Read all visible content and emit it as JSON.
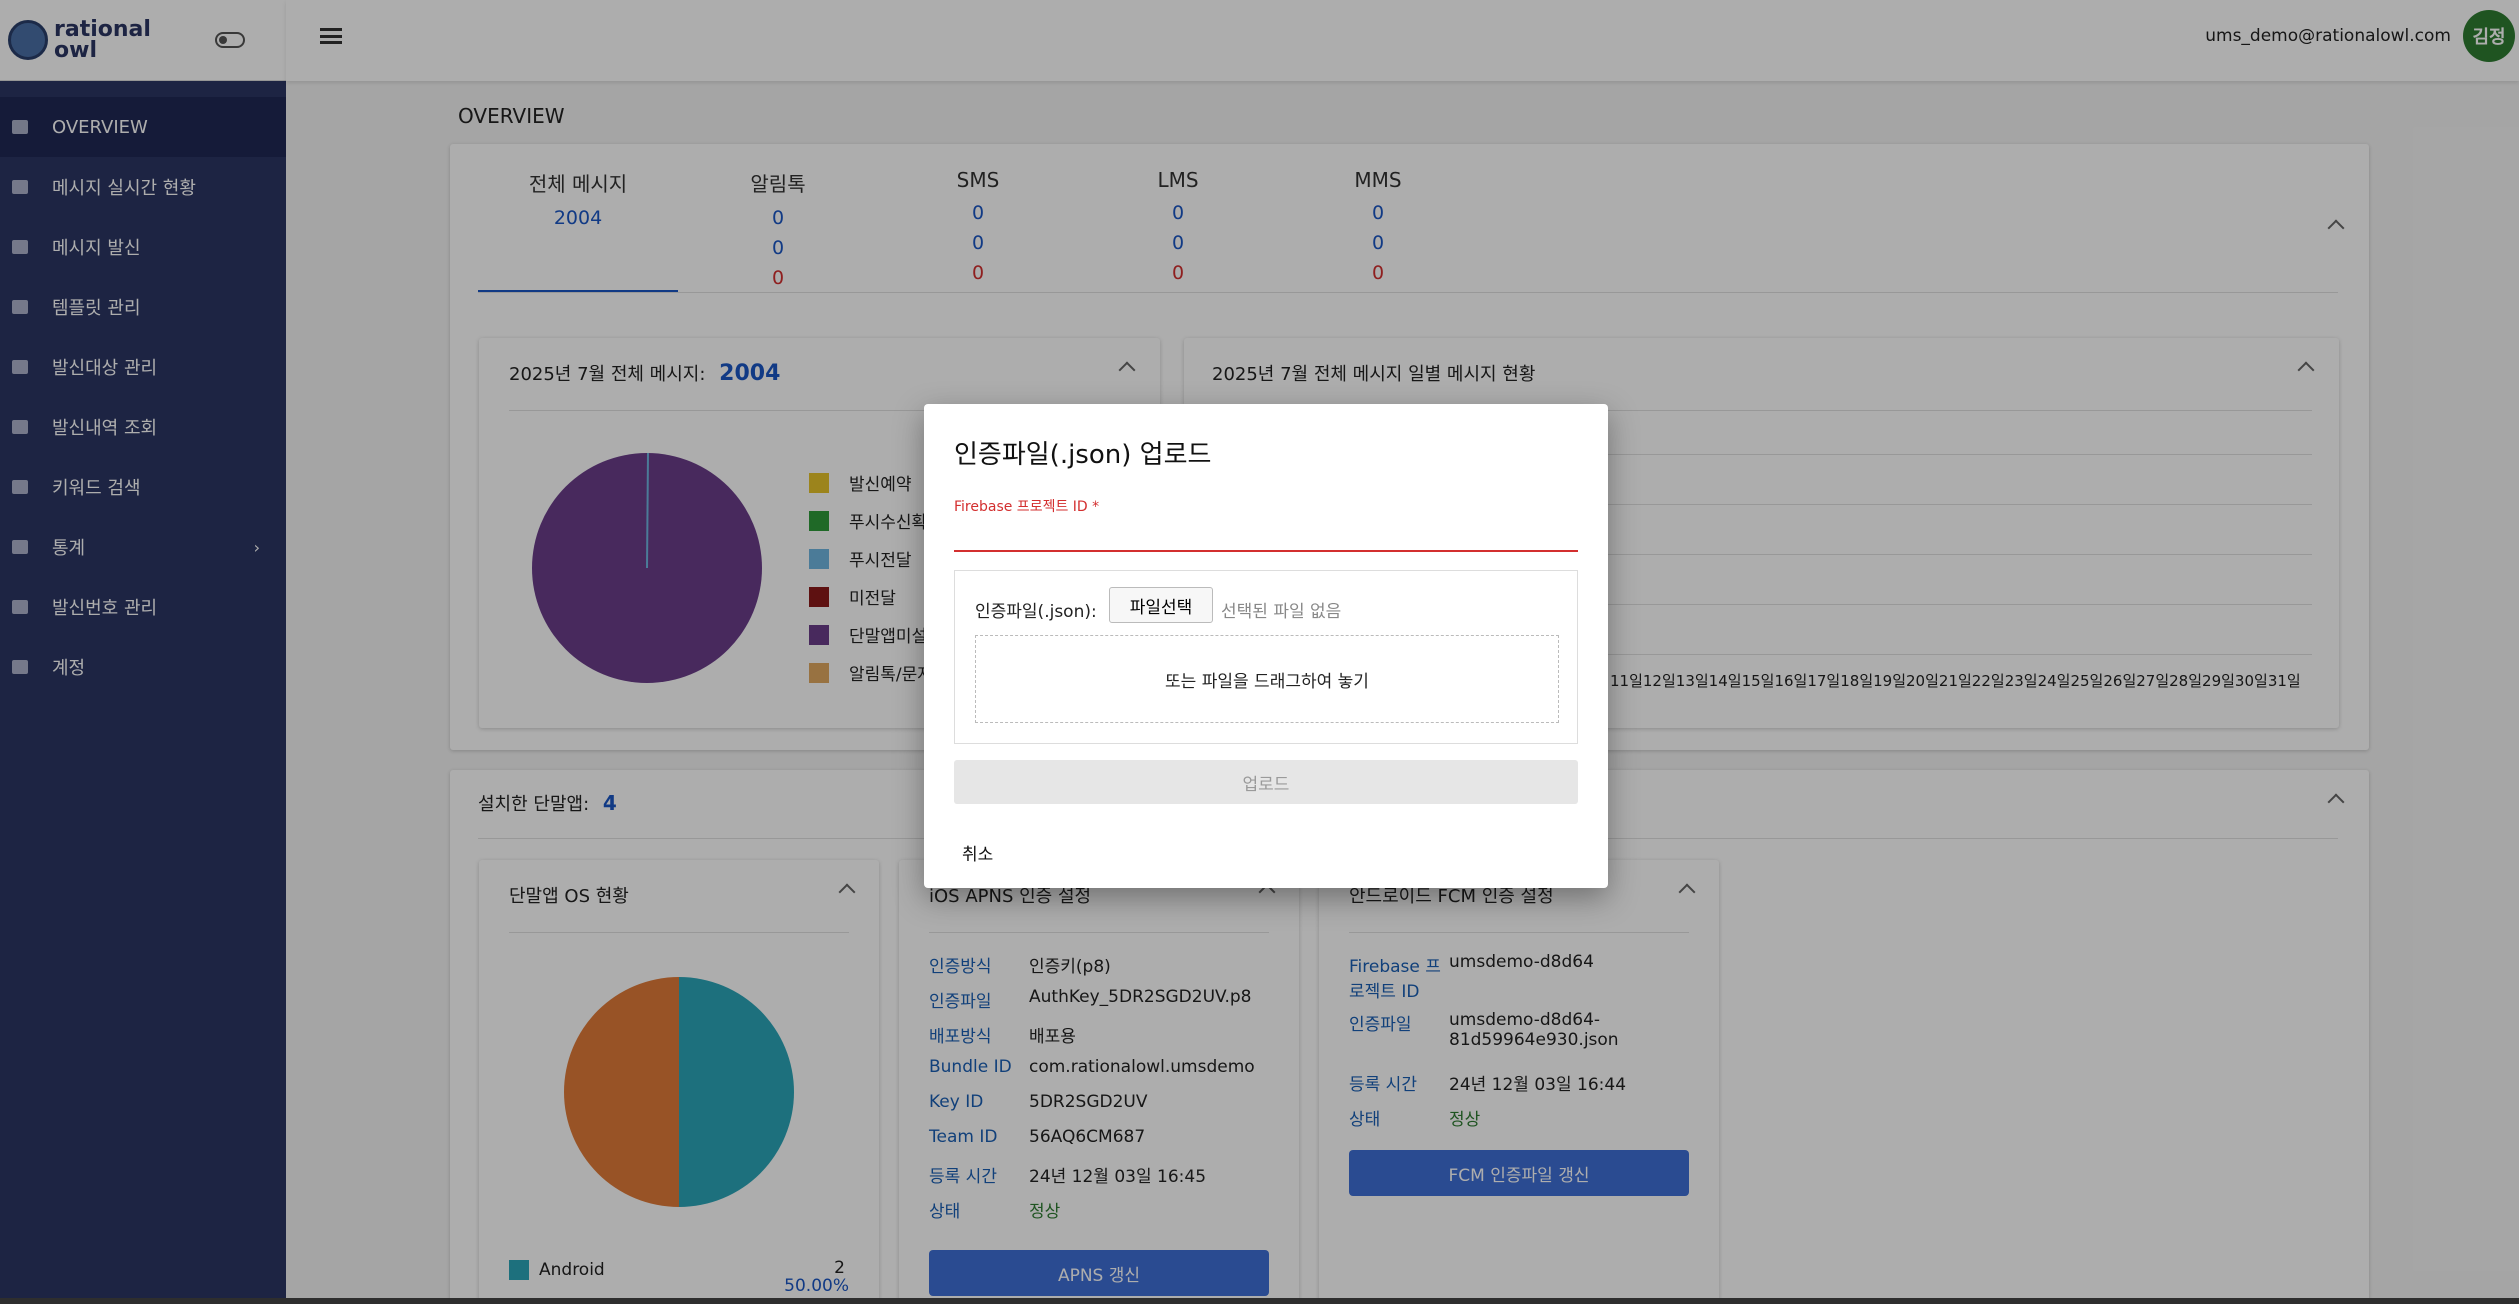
{
  "brand": {
    "name_line1": "rational",
    "name_line2": "owl"
  },
  "sidebar": {
    "items": [
      {
        "label": "OVERVIEW",
        "icon": "home-icon",
        "active": true
      },
      {
        "label": "메시지 실시간 현황",
        "icon": "chat-icon"
      },
      {
        "label": "메시지 발신",
        "icon": "send-icon"
      },
      {
        "label": "템플릿 관리",
        "icon": "template-icon"
      },
      {
        "label": "발신대상 관리",
        "icon": "people-icon"
      },
      {
        "label": "발신내역 조회",
        "icon": "document-icon"
      },
      {
        "label": "키워드 검색",
        "icon": "search-icon"
      },
      {
        "label": "통계",
        "icon": "chart-icon",
        "has_submenu": true
      },
      {
        "label": "발신번호 관리",
        "icon": "phone-icon"
      },
      {
        "label": "계정",
        "icon": "account-icon"
      }
    ]
  },
  "header": {
    "email": "ums_demo@rationalowl.com",
    "avatar_text": "김정"
  },
  "page_title": "OVERVIEW",
  "summary": {
    "columns": [
      {
        "label": "전체 메시지",
        "values": [
          "2004"
        ],
        "active": true
      },
      {
        "label": "알림톡",
        "values": [
          "0",
          "0",
          "0"
        ]
      },
      {
        "label": "SMS",
        "values": [
          "0",
          "0",
          "0"
        ]
      },
      {
        "label": "LMS",
        "values": [
          "0",
          "0",
          "0"
        ]
      },
      {
        "label": "MMS",
        "values": [
          "0",
          "0",
          "0"
        ]
      }
    ]
  },
  "monthly_card": {
    "title": "2025년 7월 전체 메시지:",
    "total": "2004",
    "legend": [
      {
        "label": "발신예약",
        "color": "#e6c32a"
      },
      {
        "label": "푸시수신확",
        "color": "#2e9b3a"
      },
      {
        "label": "푸시전달",
        "color": "#6fb6e0"
      },
      {
        "label": "미전달",
        "color": "#8b1a1a"
      },
      {
        "label": "단말앱미설",
        "color": "#6a3d8a"
      },
      {
        "label": "알림톡/문자",
        "color": "#e0a860"
      }
    ]
  },
  "daily_card": {
    "title": "2025년 7월 전체 메시지 일별 메시지 현황",
    "days": [
      "11일",
      "12일",
      "13일",
      "14일",
      "15일",
      "16일",
      "17일",
      "18일",
      "19일",
      "20일",
      "21일",
      "22일",
      "23일",
      "24일",
      "25일",
      "26일",
      "27일",
      "28일",
      "29일",
      "30일",
      "31일"
    ]
  },
  "apps_card": {
    "title": "설치한 단말앱:",
    "count": "4"
  },
  "os_card": {
    "title": "단말앱 OS 현황",
    "legend_label": "Android",
    "legend_count": "2",
    "legend_pct": "50.00%",
    "android_color": "#e07b39",
    "ios_color": "#2ba6b8"
  },
  "ios_card": {
    "title": "iOS APNS 인증 설정",
    "rows": [
      {
        "k": "인증방식",
        "v": "인증키(p8)"
      },
      {
        "k": "인증파일",
        "v": "AuthKey_5DR2SGD2UV.p8"
      },
      {
        "k": "배포방식",
        "v": "배포용"
      },
      {
        "k": "Bundle ID",
        "v": "com.rationalowl.umsdemo"
      },
      {
        "k": "Key ID",
        "v": "5DR2SGD2UV"
      },
      {
        "k": "Team ID",
        "v": "56AQ6CM687"
      },
      {
        "k": "등록 시간",
        "v": "24년 12월 03일 16:45"
      },
      {
        "k": "상태",
        "v": "정상"
      }
    ],
    "button": "APNS 갱신"
  },
  "android_card": {
    "title": "안드로이드 FCM 인증 설정",
    "rows": [
      {
        "k": "Firebase 프로젝트 ID",
        "v": "umsdemo-d8d64"
      },
      {
        "k": "인증파일",
        "v": "umsdemo-d8d64-81d59964e930.json"
      },
      {
        "k": "등록 시간",
        "v": "24년 12월 03일 16:44"
      },
      {
        "k": "상태",
        "v": "정상"
      }
    ],
    "button": "FCM 인증파일 갱신"
  },
  "modal": {
    "title": "인증파일(.json) 업로드",
    "field_label": "Firebase 프로젝트 ID *",
    "field_value": "",
    "file_label": "인증파일(.json):",
    "file_button": "파일선택",
    "file_status": "선택된 파일 없음",
    "drop_text": "또는 파일을 드래그하여 놓기",
    "upload_button": "업로드",
    "cancel_button": "취소"
  }
}
